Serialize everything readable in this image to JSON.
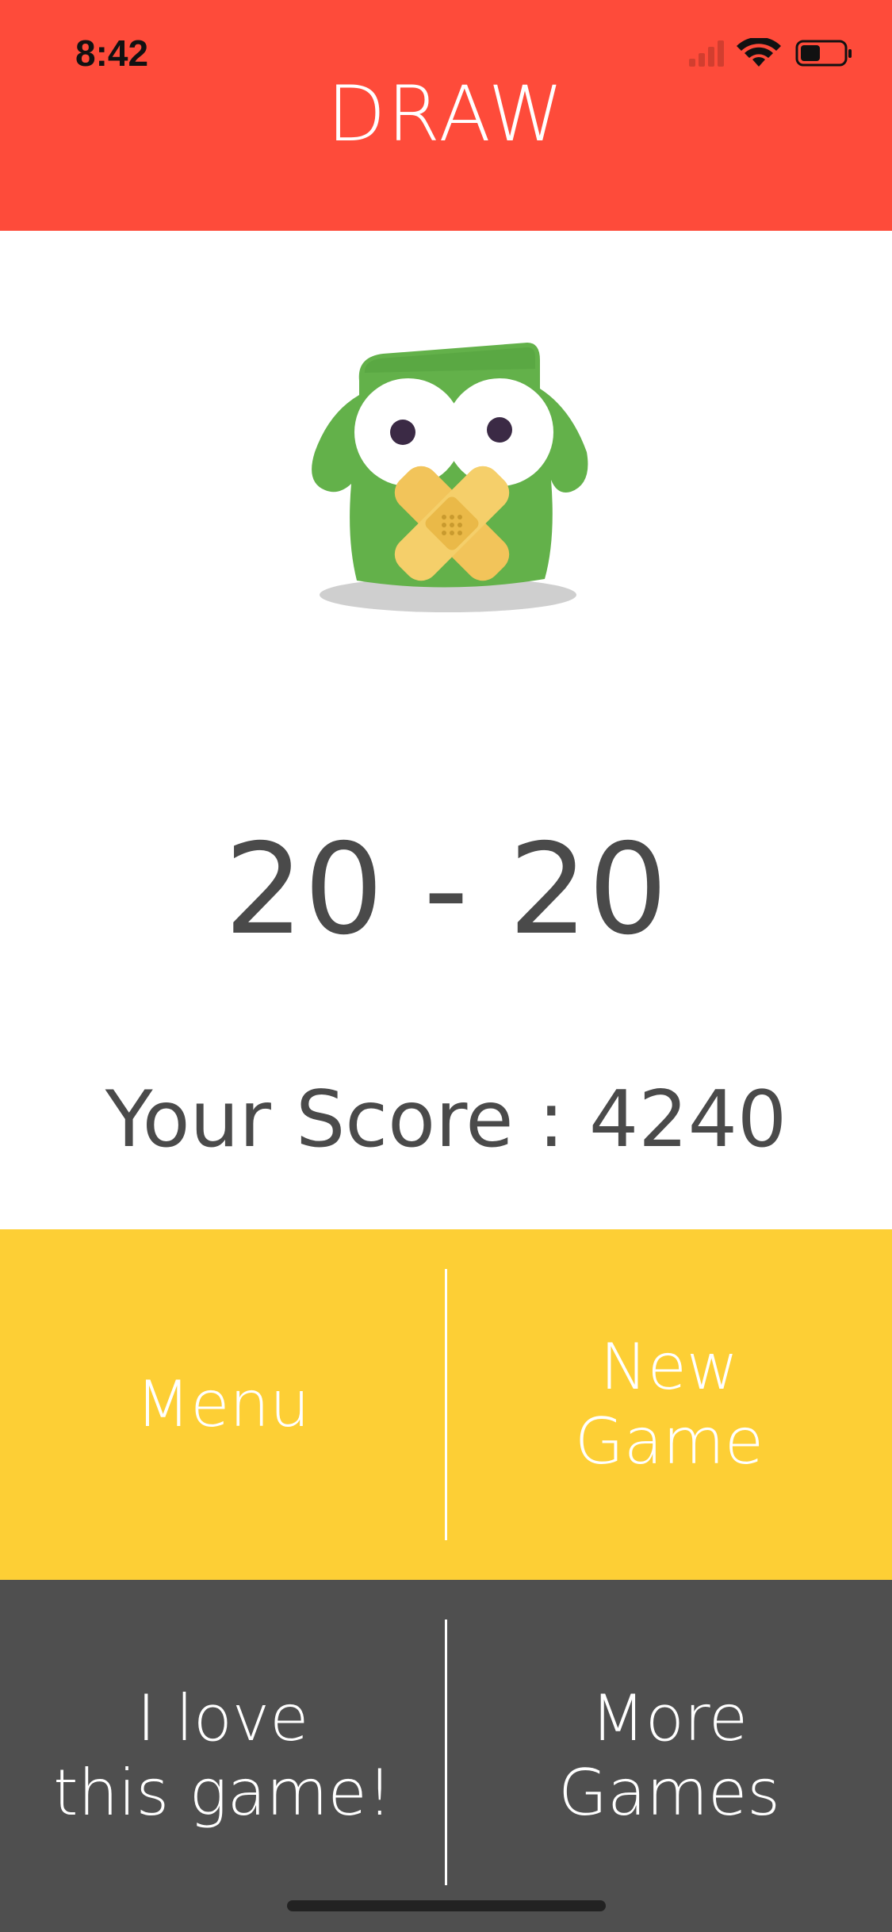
{
  "status_bar": {
    "time": "8:42"
  },
  "header": {
    "title": "DRAW",
    "color": "#fe4b3a"
  },
  "mascot": {
    "icon": "owl-mascot-taped-mouth-icon"
  },
  "result": {
    "score": "20 - 20",
    "your_score": "Your Score : 4240"
  },
  "buttons": {
    "menu": "Menu",
    "new_game": "New\nGame",
    "love_game": "I love\nthis game!",
    "more_games": "More\nGames"
  },
  "colors": {
    "yellow": "#fdcf35",
    "dark": "#4f4f4f",
    "text": "#4a4a4a"
  }
}
